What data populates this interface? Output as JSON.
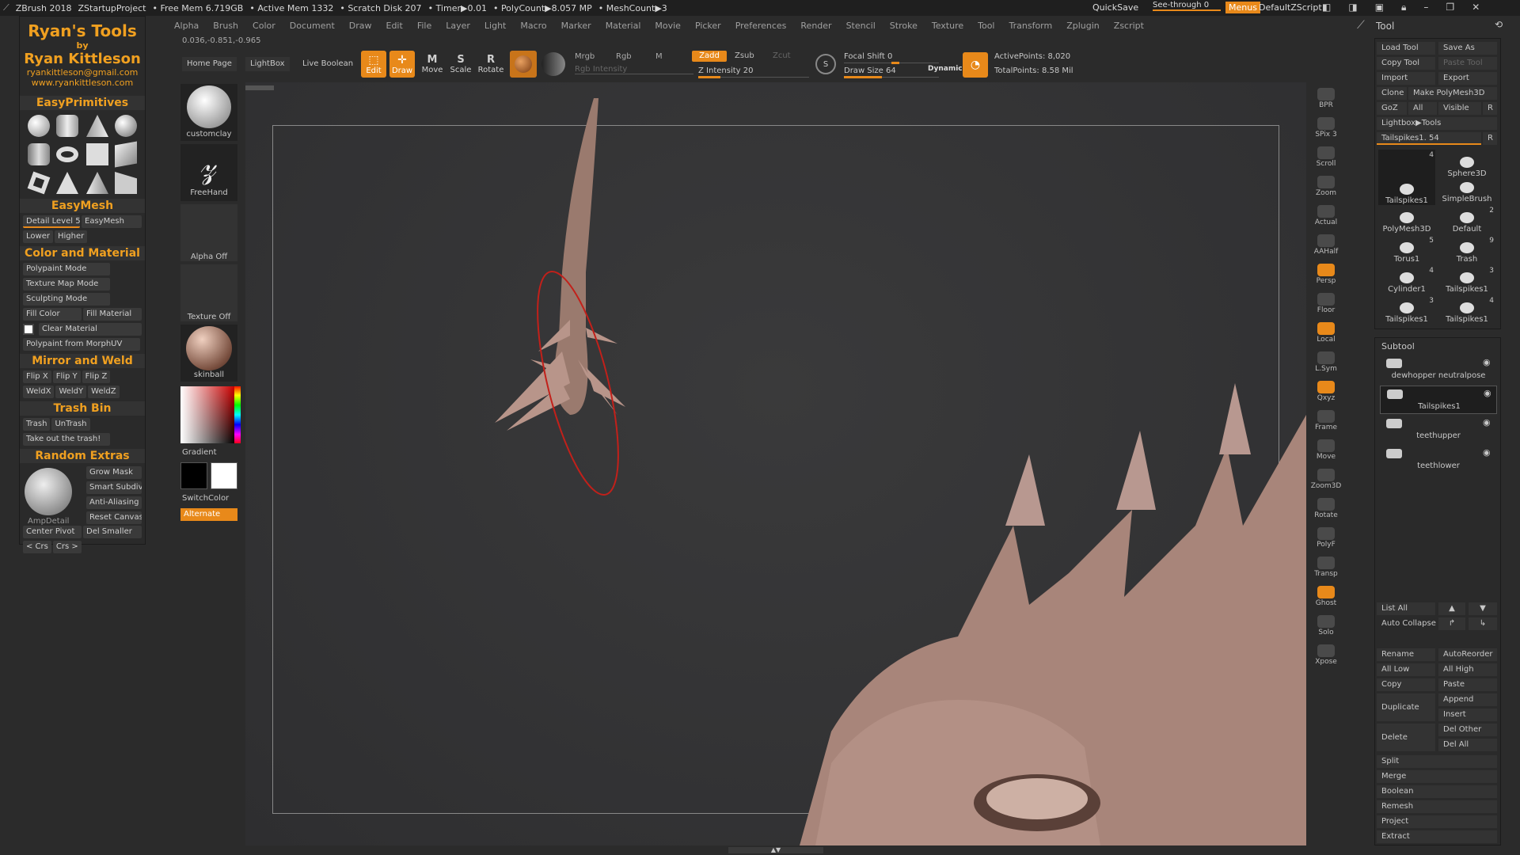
{
  "topbar": {
    "app": "ZBrush 2018",
    "project": "ZStartupProject",
    "free_mem": "• Free Mem 6.719GB",
    "active_mem": "• Active Mem 1332",
    "scratch": "• Scratch Disk 207",
    "timer": "• Timer▶0.01",
    "polycount": "• PolyCount▶8.057 MP",
    "meshcount": "• MeshCount▶3",
    "quicksave": "QuickSave",
    "see_through": "See-through 0",
    "menus": "Menus",
    "script": "DefaultZScript"
  },
  "menus": [
    "Alpha",
    "Brush",
    "Color",
    "Document",
    "Draw",
    "Edit",
    "File",
    "Layer",
    "Light",
    "Macro",
    "Marker",
    "Material",
    "Movie",
    "Picker",
    "Preferences",
    "Render",
    "Stencil",
    "Stroke",
    "Texture",
    "Tool",
    "Transform",
    "Zplugin",
    "Zscript"
  ],
  "coords": "0.036,-0.851,-0.965",
  "shelf": {
    "home": "Home Page",
    "lightbox": "LightBox",
    "liveboolean": "Live Boolean",
    "edit": "Edit",
    "draw": "Draw",
    "move": "Move",
    "scale": "Scale",
    "rotate": "Rotate",
    "mrgb": "Mrgb",
    "rgb": "Rgb",
    "m": "M",
    "rgb_intensity": "Rgb Intensity",
    "zadd": "Zadd",
    "zsub": "Zsub",
    "zcut": "Zcut",
    "z_intensity": "Z Intensity 20",
    "focal_shift": "Focal Shift 0",
    "draw_size": "Draw Size 64",
    "dynamic": "Dynamic",
    "active_points": "ActivePoints: 8,020",
    "total_points": "TotalPoints: 8.58 Mil",
    "z_intensity_level": 0.2,
    "focal_shift_level": 0.0,
    "draw_size_level": 0.4
  },
  "left": {
    "title1": "Ryan's Tools",
    "by": "by",
    "name": "Ryan Kittleson",
    "email": "ryankittleson@gmail.com",
    "web": "www.ryankittleson.com",
    "easyprimitives": "EasyPrimitives",
    "easymesh": "EasyMesh",
    "detail": "Detail Level 5",
    "easymesh_btn": "EasyMesh",
    "lower": "Lower",
    "higher": "Higher",
    "colormat": "Color and Material",
    "polypaint": "Polypaint Mode",
    "texmap": "Texture Map Mode",
    "sculpt": "Sculpting Mode",
    "fillcolor": "Fill Color",
    "fillmat": "Fill Material",
    "clearmat": "Clear Material",
    "pp_morph": "Polypaint from MorphUV",
    "mirror": "Mirror and Weld",
    "flipx": "Flip X",
    "flipy": "Flip Y",
    "flipz": "Flip Z",
    "weldx": "WeldX",
    "weldy": "WeldY",
    "weldz": "WeldZ",
    "trashbin": "Trash Bin",
    "trash": "Trash",
    "untrash": "UnTrash",
    "takeout": "Take out the trash!",
    "random": "Random Extras",
    "growmask": "Grow Mask",
    "smartsub": "Smart Subdiv",
    "antialias": "Anti-Aliasing",
    "resetcanvas": "Reset Canvas",
    "ampdetail": "AmpDetail",
    "centerpivot": "Center Pivot",
    "delsmaller": "Del Smaller",
    "prevcrs": "< Crs",
    "nextcrs": "Crs >"
  },
  "brushes": {
    "clay": "customclay",
    "freehand": "FreeHand",
    "alpha": "Alpha Off",
    "texture": "Texture Off",
    "material": "skinball",
    "gradient": "Gradient",
    "switchcolor": "SwitchColor",
    "alternate": "Alternate"
  },
  "rightbar": [
    "BPR",
    "SPix 3",
    "Scroll",
    "Zoom",
    "Actual",
    "AAHalf",
    "Persp",
    "Floor",
    "Local",
    "L.Sym",
    "Qxyz",
    "Frame",
    "Move",
    "Zoom3D",
    "Rotate",
    "PolyF",
    "Transp",
    "Ghost",
    "Solo",
    "Xpose"
  ],
  "tool": {
    "title": "Tool",
    "load": "Load Tool",
    "saveas": "Save As",
    "copy": "Copy Tool",
    "paste": "Paste Tool",
    "import": "Import",
    "export": "Export",
    "clone": "Clone",
    "makepoly": "Make PolyMesh3D",
    "goz": "GoZ",
    "all": "All",
    "visible": "Visible",
    "r": "R",
    "lightbox": "Lightbox▶Tools",
    "current": "Tailspikes1. 54",
    "r2": "R",
    "thumbs": [
      {
        "label": "Tailspikes1",
        "count": "4"
      },
      {
        "label": "Sphere3D",
        "count": ""
      },
      {
        "label": "SimpleBrush",
        "count": ""
      },
      {
        "label": "PolyMesh3D",
        "count": ""
      },
      {
        "label": "Default",
        "count": "2"
      },
      {
        "label": "Torus1",
        "count": "5"
      },
      {
        "label": "Trash",
        "count": "9"
      },
      {
        "label": "Cylinder1",
        "count": "4"
      },
      {
        "label": "Tailspikes1",
        "count": "3"
      },
      {
        "label": "Tailspikes1",
        "count": "3"
      },
      {
        "label": "Tailspikes1",
        "count": "4"
      }
    ]
  },
  "subtool": {
    "title": "Subtool",
    "items": [
      "dewhopper neutralpose",
      "Tailspikes1",
      "teethupper",
      "teethlower"
    ],
    "listall": "List All",
    "autocollapse": "Auto Collapse",
    "rename": "Rename",
    "autoreorder": "AutoReorder",
    "alllow": "All Low",
    "allhigh": "All High",
    "copy": "Copy",
    "paste": "Paste",
    "duplicate": "Duplicate",
    "append": "Append",
    "insert": "Insert",
    "delete": "Delete",
    "delother": "Del Other",
    "delall": "Del All",
    "split": "Split",
    "merge": "Merge",
    "boolean": "Boolean",
    "remesh": "Remesh",
    "project": "Project",
    "extract": "Extract"
  }
}
